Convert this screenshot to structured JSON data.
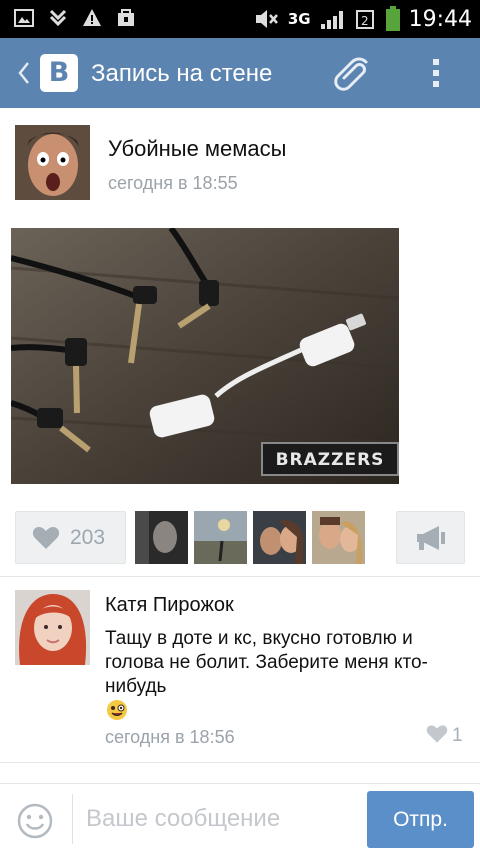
{
  "status_bar": {
    "network": "3G",
    "time": "19:44"
  },
  "header": {
    "logo": "В",
    "title": "Запись на стене",
    "icons": [
      "back-chevron-icon",
      "paperclip-icon",
      "more-vert-icon"
    ]
  },
  "post": {
    "author": "Убойные мемасы",
    "time": "сегодня в 18:55",
    "image_watermark": "BRAZZERS",
    "likes": "203",
    "liked_by_count_shown": 4
  },
  "comments": [
    {
      "author": "Катя Пирожок",
      "text": "Тащу в доте и кс, вкусно готовлю и голова не болит. Заберите меня кто-нибудь",
      "emoji": "😜",
      "time": "сегодня в 18:56",
      "likes": "1"
    }
  ],
  "composer": {
    "placeholder": "Ваше сообщение",
    "send_label": "Отпр."
  },
  "colors": {
    "header_bg": "#5b84b1",
    "send_btn": "#5b8fc9",
    "muted_text": "#9aa2aa"
  }
}
